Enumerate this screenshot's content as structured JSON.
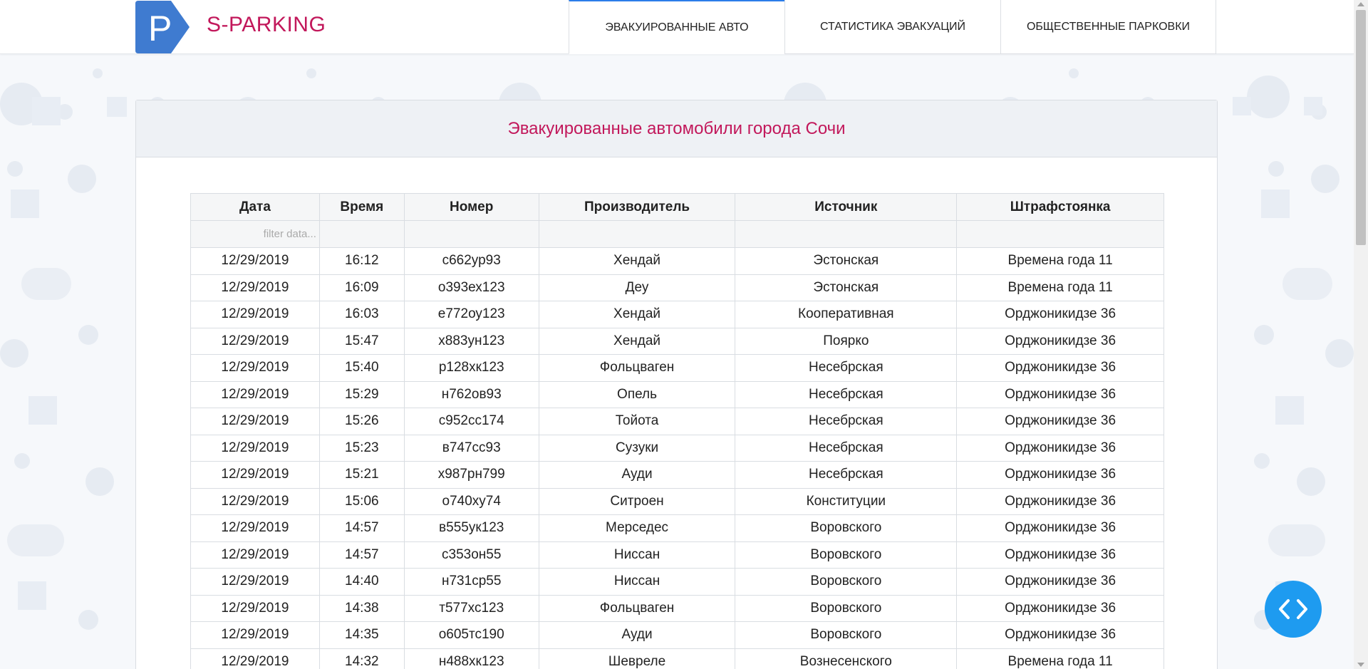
{
  "brand": {
    "logo_letter": "P",
    "name": "S-PARKING",
    "brand_color": "#c2185b",
    "badge_color": "#3f7bd0"
  },
  "nav": {
    "tabs": [
      {
        "label": "ЭВАКУИРОВАННЫЕ АВТО",
        "active": true
      },
      {
        "label": "СТАТИСТИКА ЭВАКУАЦИЙ",
        "active": false
      },
      {
        "label": "ОБЩЕСТВЕННЫЕ ПАРКОВКИ",
        "active": false
      }
    ]
  },
  "card": {
    "title": "Эвакуированные автомобили города Сочи"
  },
  "table": {
    "columns": [
      "Дата",
      "Время",
      "Номер",
      "Производитель",
      "Источник",
      "Штрафстоянка"
    ],
    "filter_placeholder": "filter data...",
    "rows": [
      [
        "12/29/2019",
        "16:12",
        "с662ур93",
        "Хендай",
        "Эстонская",
        "Времена года 11"
      ],
      [
        "12/29/2019",
        "16:09",
        "о393ех123",
        "Деу",
        "Эстонская",
        "Времена года 11"
      ],
      [
        "12/29/2019",
        "16:03",
        "е772оу123",
        "Хендай",
        "Кооперативная",
        "Орджоникидзе 36"
      ],
      [
        "12/29/2019",
        "15:47",
        "х883ун123",
        "Хендай",
        "Поярко",
        "Орджоникидзе 36"
      ],
      [
        "12/29/2019",
        "15:40",
        "р128хк123",
        "Фольцваген",
        "Несебрская",
        "Орджоникидзе 36"
      ],
      [
        "12/29/2019",
        "15:29",
        "н762ов93",
        "Опель",
        "Несебрская",
        "Орджоникидзе 36"
      ],
      [
        "12/29/2019",
        "15:26",
        "с952сс174",
        "Тойота",
        "Несебрская",
        "Орджоникидзе 36"
      ],
      [
        "12/29/2019",
        "15:23",
        "в747сс93",
        "Сузуки",
        "Несебрская",
        "Орджоникидзе 36"
      ],
      [
        "12/29/2019",
        "15:21",
        "х987рн799",
        "Ауди",
        "Несебрская",
        "Орджоникидзе 36"
      ],
      [
        "12/29/2019",
        "15:06",
        "о740ху74",
        "Ситроен",
        "Конституции",
        "Орджоникидзе 36"
      ],
      [
        "12/29/2019",
        "14:57",
        "в555ук123",
        "Мерседес",
        "Воровского",
        "Орджоникидзе 36"
      ],
      [
        "12/29/2019",
        "14:57",
        "с353он55",
        "Ниссан",
        "Воровского",
        "Орджоникидзе 36"
      ],
      [
        "12/29/2019",
        "14:40",
        "н731ср55",
        "Ниссан",
        "Воровского",
        "Орджоникидзе 36"
      ],
      [
        "12/29/2019",
        "14:38",
        "т577хс123",
        "Фольцваген",
        "Воровского",
        "Орджоникидзе 36"
      ],
      [
        "12/29/2019",
        "14:35",
        "о605тс190",
        "Ауди",
        "Воровского",
        "Орджоникидзе 36"
      ],
      [
        "12/29/2019",
        "14:32",
        "н488хк123",
        "Шевреле",
        "Вознесенского",
        "Времена года 11"
      ]
    ]
  },
  "fab": {
    "icon": "code-brackets-icon",
    "color": "#1e9bf0"
  }
}
